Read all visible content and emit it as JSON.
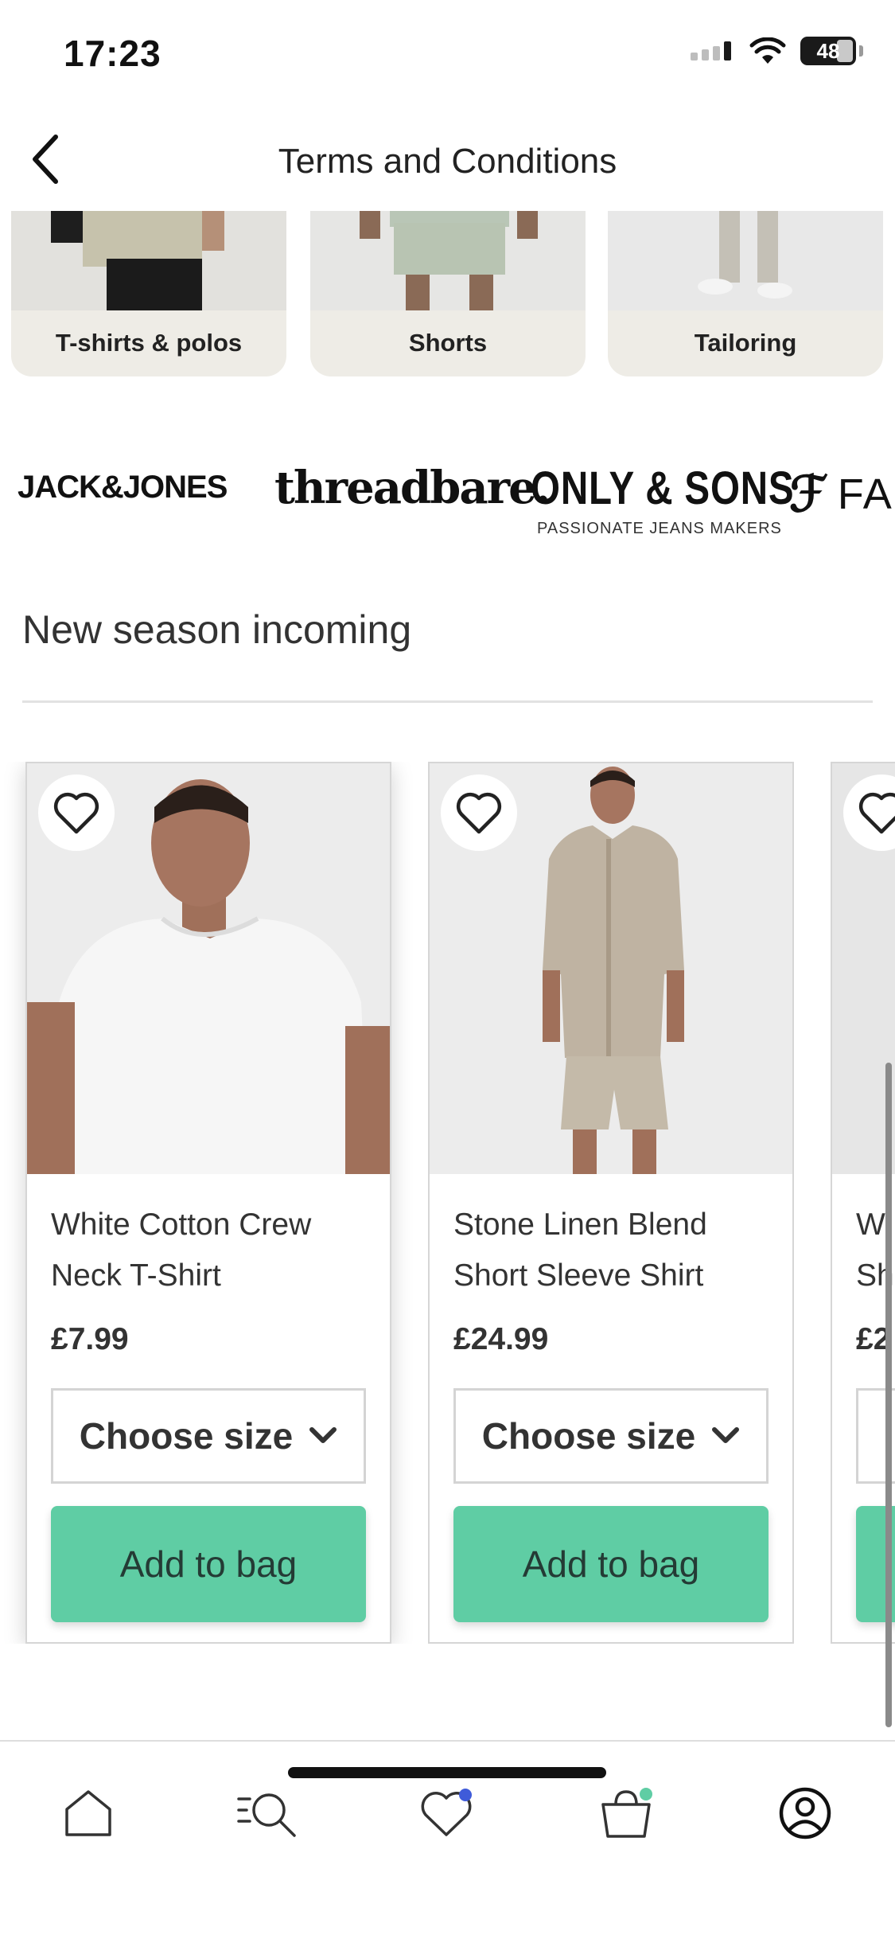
{
  "status_bar": {
    "time": "17:23",
    "battery": "48"
  },
  "header": {
    "title": "Terms and Conditions",
    "back_icon": "chevron-left-icon"
  },
  "categories": [
    {
      "label": "T-shirts & polos"
    },
    {
      "label": "Shorts"
    },
    {
      "label": "Tailoring"
    }
  ],
  "brands": [
    {
      "name": "JACK&JONES"
    },
    {
      "name": "threadbare."
    },
    {
      "name": "ONLY & SONS",
      "tagline": "PASSIONATE JEANS MAKERS"
    },
    {
      "name": "FA"
    }
  ],
  "section": {
    "title": "New season incoming"
  },
  "products": [
    {
      "name": "White Cotton Crew Neck T-Shirt",
      "price": "£7.99",
      "size_label": "Choose size",
      "cta": "Add to bag"
    },
    {
      "name": "Stone Linen Blend Short Sleeve Shirt",
      "price": "£24.99",
      "size_label": "Choose size",
      "cta": "Add to bag"
    },
    {
      "name": "W Sh",
      "price": "£2",
      "size_label": "C",
      "cta": ""
    }
  ],
  "tab_bar": {
    "items": [
      {
        "icon": "home-icon"
      },
      {
        "icon": "search-icon"
      },
      {
        "icon": "heart-icon",
        "badge_color": "#3f5bd9"
      },
      {
        "icon": "bag-icon",
        "badge_color": "#5fcda4"
      },
      {
        "icon": "account-icon"
      }
    ]
  },
  "colors": {
    "accent": "#5fcda4",
    "tile_bg": "#eeece6"
  }
}
